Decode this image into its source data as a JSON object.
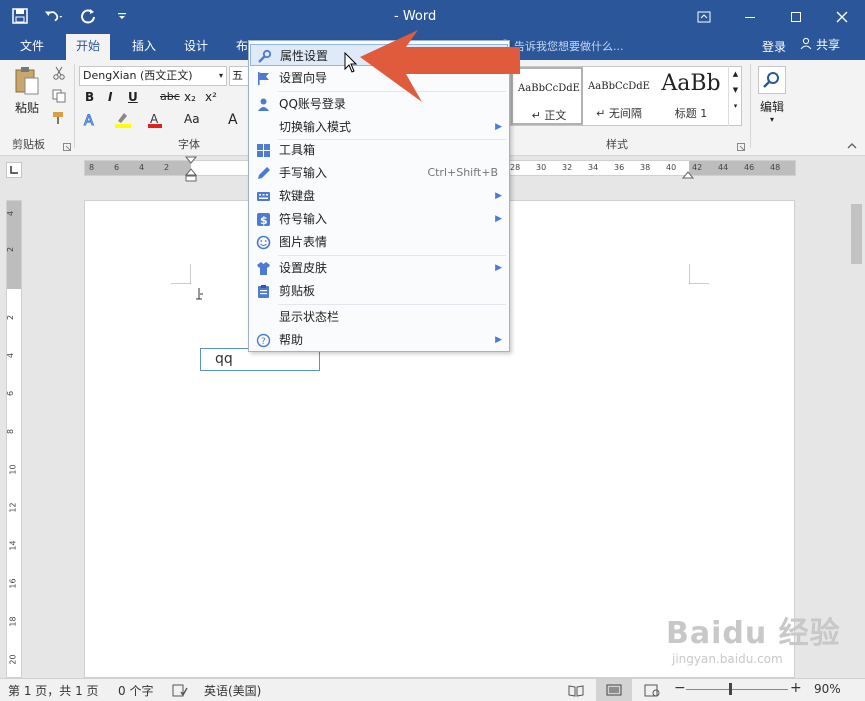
{
  "window": {
    "title": "文档1 - Word",
    "title_visible": "- Word"
  },
  "tabs": [
    {
      "label": "文件"
    },
    {
      "label": "开始"
    },
    {
      "label": "插入"
    },
    {
      "label": "设计"
    },
    {
      "label": "布"
    }
  ],
  "tell_me": "告诉我您想要做什么...",
  "account": {
    "login": "登录",
    "share": "共享"
  },
  "ribbon": {
    "clipboard": {
      "paste": "粘贴",
      "group": "剪贴板"
    },
    "font": {
      "name": "DengXian (西文正文)",
      "size": "五号",
      "group": "字体",
      "bold": "B",
      "italic": "I",
      "underline": "U",
      "strike": "abc",
      "sub": "x₂",
      "sup": "x²",
      "case": "Aa",
      "grow": "A"
    },
    "styles": {
      "group": "样式",
      "items": [
        {
          "preview": "AaBbCcDdE",
          "name": "↵ 正文"
        },
        {
          "preview": "AaBbCcDdE",
          "name": "↵ 无间隔"
        },
        {
          "preview": "AaBb",
          "name": "标题 1"
        }
      ]
    },
    "editing": {
      "label": "编辑"
    }
  },
  "ruler": {
    "left_ticks": [
      "8",
      "6",
      "4",
      "2"
    ],
    "right_ticks": [
      "28",
      "30",
      "32",
      "34",
      "36",
      "38",
      "40",
      "42",
      "44",
      "46",
      "48"
    ],
    "v_ticks": [
      "4",
      "2",
      "2",
      "4",
      "6",
      "8",
      "10",
      "12",
      "14",
      "16",
      "18",
      "20"
    ]
  },
  "document": {
    "ime_text": "qq"
  },
  "context_menu": {
    "items": [
      {
        "label": "属性设置",
        "icon": "wrench-icon",
        "highlighted": true
      },
      {
        "label": "设置向导",
        "icon": "flag-icon"
      },
      {
        "label": "QQ账号登录",
        "icon": "user-icon"
      },
      {
        "label": "切换输入模式",
        "icon": "",
        "submenu": true
      },
      {
        "label": "工具箱",
        "icon": "grid-icon"
      },
      {
        "label": "手写输入",
        "icon": "pen-icon",
        "shortcut": "Ctrl+Shift+B"
      },
      {
        "label": "软键盘",
        "icon": "keyboard-icon",
        "submenu": true
      },
      {
        "label": "符号输入",
        "icon": "dollar-icon",
        "submenu": true
      },
      {
        "label": "图片表情",
        "icon": "smile-icon"
      },
      {
        "label": "设置皮肤",
        "icon": "shirt-icon",
        "submenu": true
      },
      {
        "label": "剪贴板",
        "icon": "clipboard-icon"
      },
      {
        "label": "显示状态栏",
        "icon": ""
      },
      {
        "label": "帮助",
        "icon": "help-icon",
        "submenu": true
      }
    ]
  },
  "status_bar": {
    "page": "第 1 页，共 1 页",
    "words": "0 个字",
    "language": "英语(美国)",
    "zoom": "90%"
  },
  "watermark": {
    "brand": "Baidu 经验",
    "url": "jingyan.baidu.com"
  },
  "colors": {
    "accent": "#2b579a",
    "arrow": "#e05b3c",
    "menu_highlight": "#dfeaf8"
  }
}
